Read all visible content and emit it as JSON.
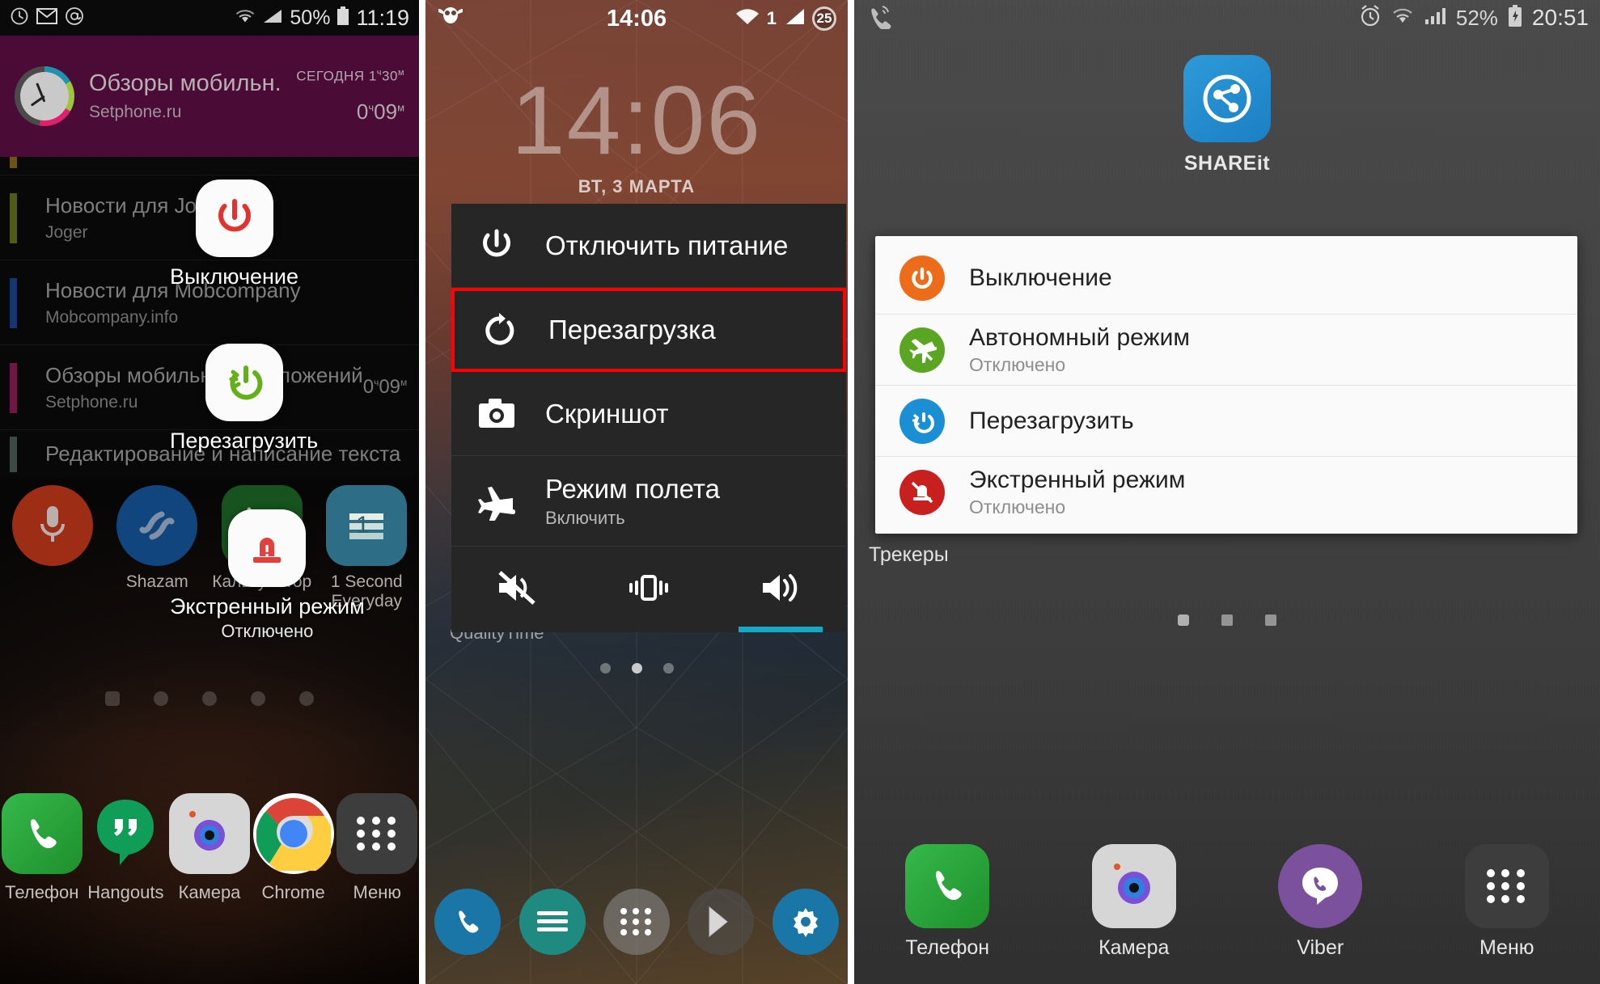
{
  "panels": [
    {
      "id": "panel-samsung-notifications",
      "status_bar": {
        "left_icons": [
          "clock-icon",
          "mail-icon",
          "at-icon"
        ],
        "right_icons": [
          "wifi-icon",
          "signal-icon"
        ],
        "battery_percent": "50%",
        "clock": "11:19"
      },
      "notification_highlight": {
        "title": "Обзоры мобильн...",
        "subtitle": "Setphone.ru",
        "today_label": "СЕГОДНЯ",
        "today_value_h": "1",
        "today_unit_h": "ч",
        "today_value_m": "30",
        "today_unit_m": "м",
        "duration_h": "0",
        "duration_unit_h": "ч",
        "duration_m": "09",
        "duration_unit_m": "м",
        "icon": "pie-clock-icon"
      },
      "notifications": [
        {
          "title": "Новости для Joger",
          "subtitle": "Joger",
          "bar_color": "#4e5a17",
          "time": ""
        },
        {
          "title": "Новости для Mobcompany",
          "subtitle": "Mobcompany.info",
          "bar_color": "#17366e",
          "time": ""
        },
        {
          "title": "Обзоры мобильных приложений",
          "subtitle": "Setphone.ru",
          "bar_color": "#6e1745",
          "time_value": "0",
          "time_unit_h": "ч",
          "time_m": "09",
          "time_unit_m": "м"
        },
        {
          "title": "Редактирование и написание текста",
          "subtitle": "",
          "bar_color": "#3c4a44",
          "time": ""
        }
      ],
      "apps_row": [
        {
          "label": "",
          "icon": "microphone-icon",
          "color": "#9e2d15"
        },
        {
          "label": "Shazam",
          "icon": "shazam-icon",
          "color": "#10457e"
        },
        {
          "label": "Калькулятор",
          "icon": "calculator-icon",
          "color": "#16531e"
        },
        {
          "label": "1 Second Everyday",
          "icon": "one-second-everyday-icon",
          "color": "#2d6e86"
        }
      ],
      "callouts": [
        {
          "label": "Выключение",
          "sublabel": "",
          "icon": "power-off-icon",
          "icon_color": "#e0322e"
        },
        {
          "label": "Перезагрузить",
          "sublabel": "",
          "icon": "restart-icon",
          "icon_color": "#63b019"
        },
        {
          "label": "Экстренный режим",
          "sublabel": "Отключено",
          "icon": "emergency-siren-icon",
          "icon_color": "#e0413c"
        }
      ],
      "dock": [
        {
          "label": "Телефон",
          "icon": "phone-icon",
          "color": "#2bab3b"
        },
        {
          "label": "Hangouts",
          "icon": "hangouts-icon",
          "color": "#0f9d58"
        },
        {
          "label": "Камера",
          "icon": "camera-icon",
          "color": "#d8d8d8"
        },
        {
          "label": "Chrome",
          "icon": "chrome-icon",
          "color": "#ffffff"
        },
        {
          "label": "Меню",
          "icon": "app-drawer-icon",
          "color": "#3f3f3f"
        }
      ]
    },
    {
      "id": "panel-cyanogen-power-menu",
      "status_bar": {
        "left_icons": [
          "owl-app-icon"
        ],
        "clock": "14:06",
        "right_icons": [
          "wifi-icon",
          "signal-icon"
        ],
        "signal_label": "1",
        "battery_badge": "25"
      },
      "lockscreen": {
        "clock": "14:06",
        "date": "ВТ, 3 МАРТА",
        "widget_label": "QualityTime"
      },
      "power_menu": [
        {
          "label": "Отключить питание",
          "sublabel": "",
          "icon": "power-off-icon",
          "highlighted": false
        },
        {
          "label": "Перезагрузка",
          "sublabel": "",
          "icon": "restart-icon",
          "highlighted": true
        },
        {
          "label": "Скриншот",
          "sublabel": "",
          "icon": "camera-icon",
          "highlighted": false
        },
        {
          "label": "Режим полета",
          "sublabel": "Включить",
          "icon": "airplane-icon",
          "highlighted": false
        }
      ],
      "volume_row": [
        {
          "icon": "mute-icon",
          "active": false
        },
        {
          "icon": "vibrate-icon",
          "active": false
        },
        {
          "icon": "sound-on-icon",
          "active": true
        }
      ],
      "highlight_color": "#ff0000",
      "accent_color": "#14a9c4",
      "dock": [
        {
          "icon": "phone-icon",
          "color": "#1b76a8"
        },
        {
          "icon": "menu-lines-icon",
          "color": "#1f8b80"
        },
        {
          "icon": "app-drawer-icon",
          "color": "#707070"
        },
        {
          "icon": "play-store-icon",
          "color": "#4f4f4f"
        },
        {
          "icon": "settings-gear-icon",
          "color": "#1b76a8"
        }
      ]
    },
    {
      "id": "panel-samsung-power-dialog",
      "status_bar": {
        "left_icons": [
          "phone-call-icon"
        ],
        "right_icons": [
          "alarm-icon",
          "wifi-icon",
          "signal-icon"
        ],
        "battery_percent": "52%",
        "battery_state": "charging",
        "clock": "20:51"
      },
      "home": {
        "app_label": "SHAREit",
        "app_icon": "shareit-icon",
        "folder_label": "Трекеры"
      },
      "power_dialog": [
        {
          "label": "Выключение",
          "sublabel": "",
          "icon": "power-off-icon",
          "color": "#ec6c1a"
        },
        {
          "label": "Автономный режим",
          "sublabel": "Отключено",
          "icon": "airplane-off-icon",
          "color": "#5aa521"
        },
        {
          "label": "Перезагрузить",
          "sublabel": "",
          "icon": "restart-icon",
          "color": "#1b8fd4"
        },
        {
          "label": "Экстренный режим",
          "sublabel": "Отключено",
          "icon": "emergency-off-icon",
          "color": "#c8201f"
        }
      ],
      "dock": [
        {
          "label": "Телефон",
          "icon": "phone-icon",
          "color": "#2bab3b"
        },
        {
          "label": "Камера",
          "icon": "camera-icon",
          "color": "#d8d8d8"
        },
        {
          "label": "Viber",
          "icon": "viber-icon",
          "color": "#7b519d"
        },
        {
          "label": "Меню",
          "icon": "app-drawer-icon",
          "color": "#3f3f3f"
        }
      ]
    }
  ]
}
